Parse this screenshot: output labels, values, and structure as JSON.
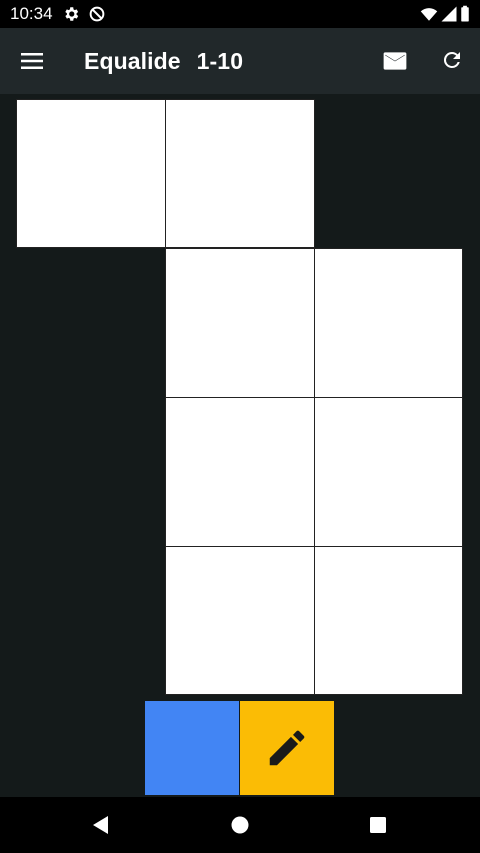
{
  "status_bar": {
    "time": "10:34",
    "icons": [
      "gear-icon",
      "no-sync-icon",
      "wifi-icon",
      "signal-icon",
      "battery-icon"
    ]
  },
  "app_bar": {
    "title": "Equalide",
    "level": "1-10",
    "icons": [
      "menu-icon",
      "mail-icon",
      "refresh-icon"
    ]
  },
  "colors": {
    "background": "#141a1a",
    "app_bar": "#21282a",
    "cell": "#ffffff",
    "palette_blue": "#4285f4",
    "palette_yellow": "#fbbc05"
  },
  "palette": {
    "colors": [
      "#4285f4",
      "#fbbc05"
    ],
    "icons": [
      "pencil-icon"
    ]
  },
  "nav_bar": {
    "icons": [
      "back-icon",
      "home-icon",
      "recents-icon"
    ]
  }
}
